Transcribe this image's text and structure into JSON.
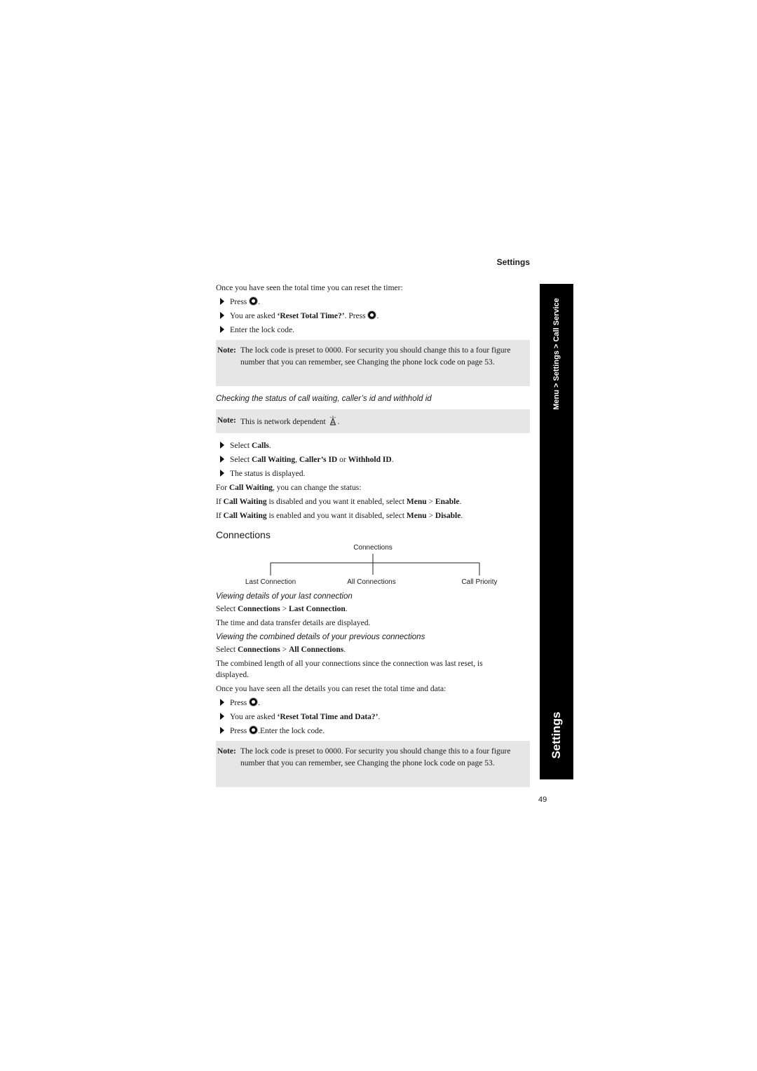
{
  "header": {
    "section": "Settings"
  },
  "sidebar": {
    "breadcrumb": "Menu > Settings > Call Service",
    "tab": "Settings"
  },
  "page_number": "49",
  "reset_timer": {
    "intro": "Once you have seen the total time you can reset the timer:",
    "steps": [
      {
        "pre": "Press ",
        "icon": "select-button-icon",
        "post": "."
      },
      {
        "pre": "You are asked ",
        "bold": "‘Reset Total Time?’",
        "mid": ". Press ",
        "icon": "select-button-icon",
        "post": "."
      },
      {
        "pre": "Enter the lock code."
      }
    ]
  },
  "note1": {
    "label": "Note:",
    "text": "The lock code is preset to 0000. For security you should change this to a four figure number that you can remember, see Changing the phone lock code on page 53."
  },
  "call_status": {
    "heading": "Checking the status of call waiting, caller’s id and withhold id",
    "note_label": "Note:",
    "note_text": "This is network dependent",
    "note_icon": "network-antenna-icon",
    "steps": [
      {
        "pre": "Select ",
        "b1": "Calls",
        "post": "."
      },
      {
        "pre": "Select ",
        "b1": "Call Waiting",
        "m1": ", ",
        "b2": "Caller’s ID",
        "m2": " or ",
        "b3": "Withhold ID",
        "post": "."
      },
      {
        "pre": "The status is displayed."
      }
    ],
    "lines": [
      {
        "pre": "For ",
        "b1": "Call Waiting",
        "post": ", you can change the status:"
      },
      {
        "pre": "If ",
        "b1": "Call Waiting",
        "m1": " is disabled and you want it enabled, select ",
        "b2": "Menu",
        "m2": " > ",
        "b3": "Enable",
        "post": "."
      },
      {
        "pre": "If ",
        "b1": "Call Waiting",
        "m1": " is enabled and you want it disabled, select ",
        "b2": "Menu",
        "m2": " > ",
        "b3": "Disable",
        "post": "."
      }
    ]
  },
  "connections": {
    "title": "Connections",
    "tree": {
      "root": "Connections",
      "children": [
        "Last Connection",
        "All Connections",
        "Call Priority"
      ]
    },
    "last": {
      "heading": "Viewing details of your last connection",
      "select_pre": "Select ",
      "b1": "Connections",
      "m1": " > ",
      "b2": "Last Connection",
      "post": ".",
      "desc": "The time and data transfer details are displayed."
    },
    "all": {
      "heading": "Viewing the combined details of your previous connections",
      "select_pre": "Select ",
      "b1": "Connections",
      "m1": " > ",
      "b2": "All Connections",
      "post": ".",
      "desc_line1": "The combined length of all your connections since the connection was last reset, is",
      "desc_line2": "displayed."
    },
    "reset": {
      "intro": "Once you have seen all the details you can reset the total time and data:",
      "steps": [
        {
          "pre": "Press ",
          "post": "."
        },
        {
          "pre": "You are asked ",
          "bold": "‘Reset Total Time and Data?’",
          "post": "."
        },
        {
          "pre": "Press ",
          "post": ".Enter the lock code."
        }
      ]
    }
  },
  "note2": {
    "label": "Note:",
    "text": "The lock code is preset to 0000. For security you should change this to a four figure number that you can remember, see Changing the phone lock code on page 53."
  }
}
